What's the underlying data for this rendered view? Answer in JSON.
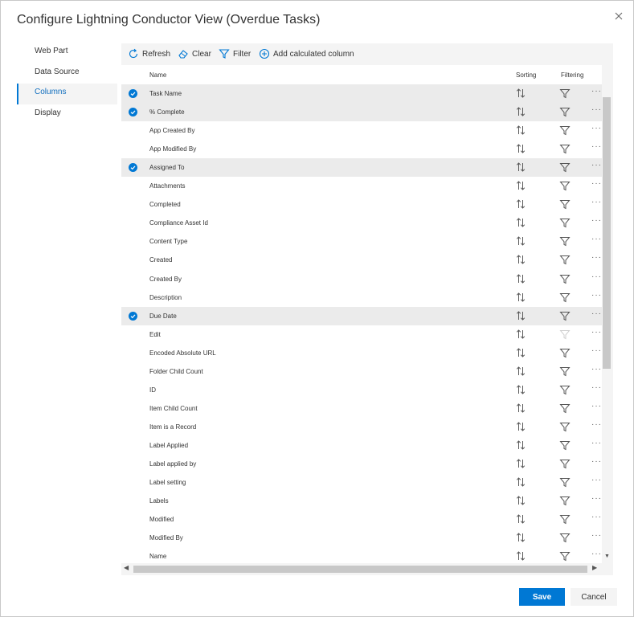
{
  "dialog": {
    "title": "Configure Lightning Conductor View (Overdue Tasks)"
  },
  "nav": [
    {
      "label": "Web Part",
      "active": false
    },
    {
      "label": "Data Source",
      "active": false
    },
    {
      "label": "Columns",
      "active": true
    },
    {
      "label": "Display",
      "active": false
    }
  ],
  "toolbar": {
    "refresh": "Refresh",
    "clear": "Clear",
    "filter": "Filter",
    "add_calculated": "Add calculated column"
  },
  "table": {
    "headers": {
      "name": "Name",
      "sorting": "Sorting",
      "filtering": "Filtering"
    },
    "rows": [
      {
        "name": "Task Name",
        "selected": true,
        "filter_enabled": true
      },
      {
        "name": "% Complete",
        "selected": true,
        "filter_enabled": true
      },
      {
        "name": "App Created By",
        "selected": false,
        "filter_enabled": true
      },
      {
        "name": "App Modified By",
        "selected": false,
        "filter_enabled": true
      },
      {
        "name": "Assigned To",
        "selected": true,
        "filter_enabled": true
      },
      {
        "name": "Attachments",
        "selected": false,
        "filter_enabled": true
      },
      {
        "name": "Completed",
        "selected": false,
        "filter_enabled": true
      },
      {
        "name": "Compliance Asset Id",
        "selected": false,
        "filter_enabled": true
      },
      {
        "name": "Content Type",
        "selected": false,
        "filter_enabled": true
      },
      {
        "name": "Created",
        "selected": false,
        "filter_enabled": true
      },
      {
        "name": "Created By",
        "selected": false,
        "filter_enabled": true
      },
      {
        "name": "Description",
        "selected": false,
        "filter_enabled": true
      },
      {
        "name": "Due Date",
        "selected": true,
        "filter_enabled": true
      },
      {
        "name": "Edit",
        "selected": false,
        "filter_enabled": false
      },
      {
        "name": "Encoded Absolute URL",
        "selected": false,
        "filter_enabled": true
      },
      {
        "name": "Folder Child Count",
        "selected": false,
        "filter_enabled": true
      },
      {
        "name": "ID",
        "selected": false,
        "filter_enabled": true
      },
      {
        "name": "Item Child Count",
        "selected": false,
        "filter_enabled": true
      },
      {
        "name": "Item is a Record",
        "selected": false,
        "filter_enabled": true
      },
      {
        "name": "Label Applied",
        "selected": false,
        "filter_enabled": true
      },
      {
        "name": "Label applied by",
        "selected": false,
        "filter_enabled": true
      },
      {
        "name": "Label setting",
        "selected": false,
        "filter_enabled": true
      },
      {
        "name": "Labels",
        "selected": false,
        "filter_enabled": true
      },
      {
        "name": "Modified",
        "selected": false,
        "filter_enabled": true
      },
      {
        "name": "Modified By",
        "selected": false,
        "filter_enabled": true
      },
      {
        "name": "Name",
        "selected": false,
        "filter_enabled": true
      }
    ]
  },
  "icons": {
    "close": "close-icon",
    "refresh": "refresh-icon",
    "clear": "eraser-icon",
    "filter": "filter-icon",
    "add": "add-circle-icon",
    "check": "checkmark-circle-icon",
    "sort": "sort-icon",
    "more": "more-icon"
  },
  "footer": {
    "save": "Save",
    "cancel": "Cancel"
  },
  "colors": {
    "accent": "#0078d4",
    "selected_row": "#ebebeb",
    "panel_bg": "#f4f4f4"
  }
}
